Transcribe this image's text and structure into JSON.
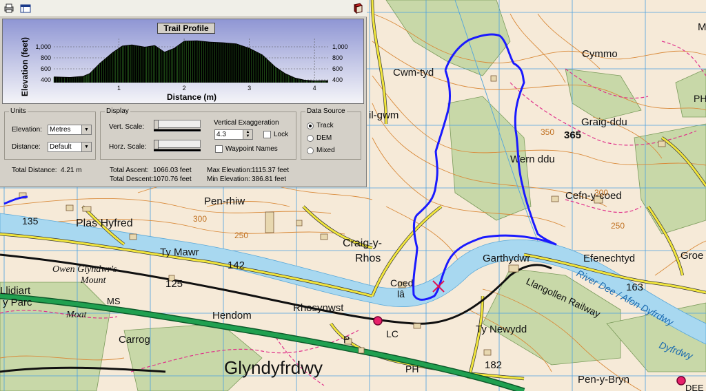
{
  "profile": {
    "title": "Trail Profile",
    "y_label": "Elevation (feet)",
    "x_label": "Distance (m)",
    "y_ticks": [
      "1,000",
      "800",
      "600",
      "400"
    ],
    "x_ticks": [
      "1",
      "2",
      "3",
      "4"
    ]
  },
  "chart_data": {
    "type": "area",
    "title": "Trail Profile",
    "xlabel": "Distance (m)",
    "ylabel": "Elevation (feet)",
    "xlim": [
      0,
      4.21
    ],
    "ylim": [
      350,
      1150
    ],
    "x": [
      0,
      0.25,
      0.45,
      0.55,
      0.7,
      0.9,
      1.05,
      1.2,
      1.4,
      1.55,
      1.7,
      1.85,
      2.0,
      2.2,
      2.4,
      2.6,
      2.8,
      3.0,
      3.2,
      3.4,
      3.55,
      3.7,
      3.85,
      4.0,
      4.1,
      4.21
    ],
    "series": [
      {
        "values": [
          460,
          450,
          470,
          520,
          700,
          900,
          1020,
          1040,
          1000,
          1030,
          910,
          980,
          1110,
          1115,
          1090,
          1080,
          1060,
          980,
          860,
          640,
          520,
          440,
          400,
          387,
          390,
          390
        ]
      }
    ],
    "grid": true
  },
  "units": {
    "title": "Units",
    "elevation_label": "Elevation:",
    "elevation_value": "Metres",
    "distance_label": "Distance:",
    "distance_value": "Default"
  },
  "display": {
    "title": "Display",
    "vert_scale_label": "Vert. Scale:",
    "horz_scale_label": "Horz. Scale:",
    "vertical_exaggeration_label": "Vertical Exaggeration",
    "vertical_exaggeration_value": "4.3",
    "lock_label": "Lock",
    "waypoint_names_label": "Waypoint Names"
  },
  "data_source": {
    "title": "Data Source",
    "options": [
      "Track",
      "DEM",
      "Mixed"
    ],
    "selected": "Track"
  },
  "stats": {
    "total_distance_label": "Total Distance:",
    "total_distance_value": "4.21 m",
    "total_ascent_label": "Total Ascent:",
    "total_ascent_value": "1066.03 feet",
    "total_descent_label": "Total Descent:",
    "total_descent_value": "1070.76 feet",
    "max_elevation_label": "Max Elevation:",
    "max_elevation_value": "1115.37 feet",
    "min_elevation_label": "Min Elevation:",
    "min_elevation_value": "386.81 feet"
  },
  "map": {
    "labels": {
      "cwm_tyddu": "Cwm-tyd",
      "cymmo": "Cymmo",
      "graig_ddu": "Graig-ddu",
      "spot_365": "365",
      "wern_ddu": "Wern ddu",
      "cefn_y_coed": "Cefn-y-coed",
      "il_gwm": "il-gwm",
      "pen_rhiw": "Pen-rhiw",
      "plas_hyfred": "Plas Hyfred",
      "n135": "135",
      "ty_mawr": "Ty Mawr",
      "n142": "142",
      "n125": "125",
      "craig_y": "Craig-y-",
      "rhos": "Rhos",
      "garthydwr": "Garthydwr",
      "efenechtyd": "Efenechtyd",
      "groe": "Groe",
      "owen_glyndwr": "Owen Glyndwr's",
      "mount": "Mount",
      "lliidiart": "Llidiart",
      "y_parc": "y Parc",
      "ms": "MS",
      "moat": "Moat",
      "hendom": "Hendom",
      "rhosynwst": "Rhosynwst",
      "coed_la": "Coed",
      "la": "lâ",
      "n163": "163",
      "river_dee": "River Dee / Afon Dyfrdwy",
      "llangollen_railway": "Llangollen Railway",
      "ty_newydd": "Ty Newydd",
      "carrog": "Carrog",
      "lc": "LC",
      "glyndyfrdwy": "Glyndyfrdwy",
      "ph": "PH",
      "p": "P",
      "n182": "182",
      "pen_y_bryn": "Pen-y-Bryn",
      "dyfrdwy": "Dyfrdwy",
      "ph_right": "PH",
      "m_top": "M",
      "c300": "300",
      "c350": "350",
      "c250": "250",
      "c300b": "300",
      "c250b": "250",
      "dee_part": "DEE"
    },
    "colors": {
      "track": "#1a1aff",
      "grid": "#4aa0e0",
      "contour": "#d98a3a",
      "river": "#a8d8f0",
      "road_yellow": "#f2e63c",
      "road_green": "#20a050",
      "rail": "#101010",
      "path": "#e0308a",
      "woods": "#c8d8a8"
    }
  }
}
